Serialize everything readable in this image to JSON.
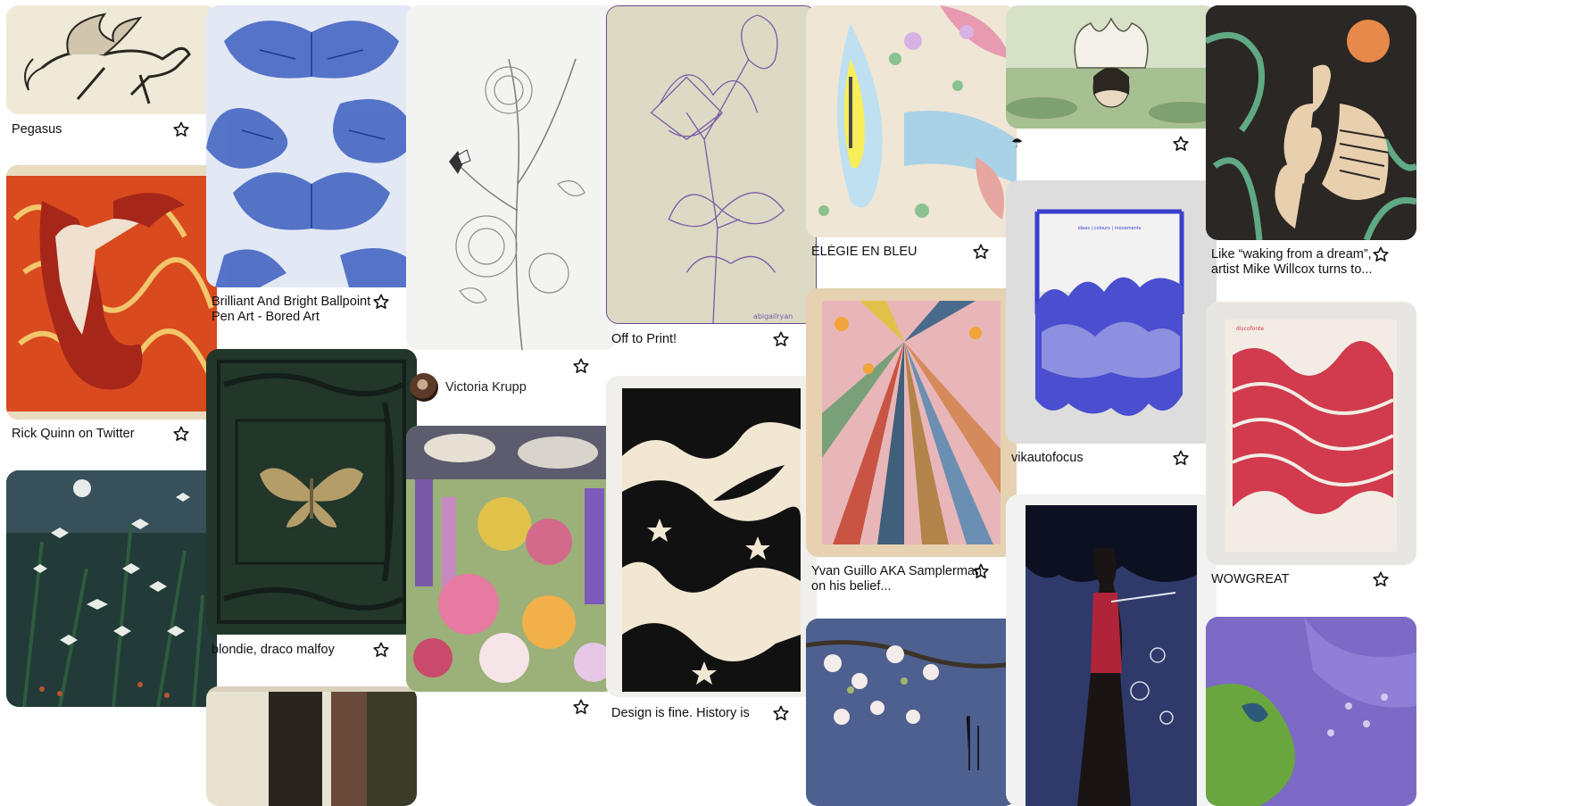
{
  "colors": {
    "text": "#111111",
    "star": "#111111",
    "background": "#ffffff"
  },
  "pins": [
    {
      "id": "pegasus",
      "title": "Pegasus",
      "image": "pegasus-engraving"
    },
    {
      "id": "rick",
      "title": "Rick Quinn on Twitter",
      "image": "jugend-red-poster"
    },
    {
      "id": "moths",
      "title": "",
      "image": "night-moths-painting"
    },
    {
      "id": "butterflies",
      "title": "Brilliant And Bright Ballpoint Pen Art - Bored Art",
      "image": "blue-ballpoint-butterflies"
    },
    {
      "id": "blondie",
      "title": "blondie, draco malfoy",
      "image": "green-book-cover"
    },
    {
      "id": "pencil",
      "title": "",
      "image": "pencil-flower-sketch"
    },
    {
      "id": "victoria",
      "author": "Victoria Krupp"
    },
    {
      "id": "collage",
      "title": "",
      "image": "flower-collage"
    },
    {
      "id": "print",
      "title": "Off to Print!",
      "image": "purple-flower-drawing"
    },
    {
      "id": "design",
      "title": "Design is fine. History is",
      "image": "black-white-swirl"
    },
    {
      "id": "elegie",
      "title": "ÉLÉGIE EN BLEU",
      "image": "pattern-painting"
    },
    {
      "id": "yvan",
      "title": "Yvan Guillo AKA Samplerman on his belief...",
      "image": "samplerman-collage"
    },
    {
      "id": "blossom",
      "title": "",
      "image": "cherry-blossom-print"
    },
    {
      "id": "lotus",
      "title": "☂",
      "image": "lotus-woman"
    },
    {
      "id": "vikauto",
      "title": "vikautofocus",
      "image": "blue-poster"
    },
    {
      "id": "erte",
      "title": "",
      "image": "art-deco-lady"
    },
    {
      "id": "waking",
      "title": "Like “waking from a dream”, artist Mike Willcox turns to...",
      "image": "herons-sun"
    },
    {
      "id": "wowgreat",
      "title": "WOWGREAT",
      "image": "red-waves-poster"
    },
    {
      "id": "purple",
      "title": "",
      "image": "purple-green-painting"
    }
  ],
  "posters": {
    "vikauto_header": "ideas | colours | movements",
    "wowgreat_header": "discofonte",
    "pencil_sig": "abigailryan"
  }
}
